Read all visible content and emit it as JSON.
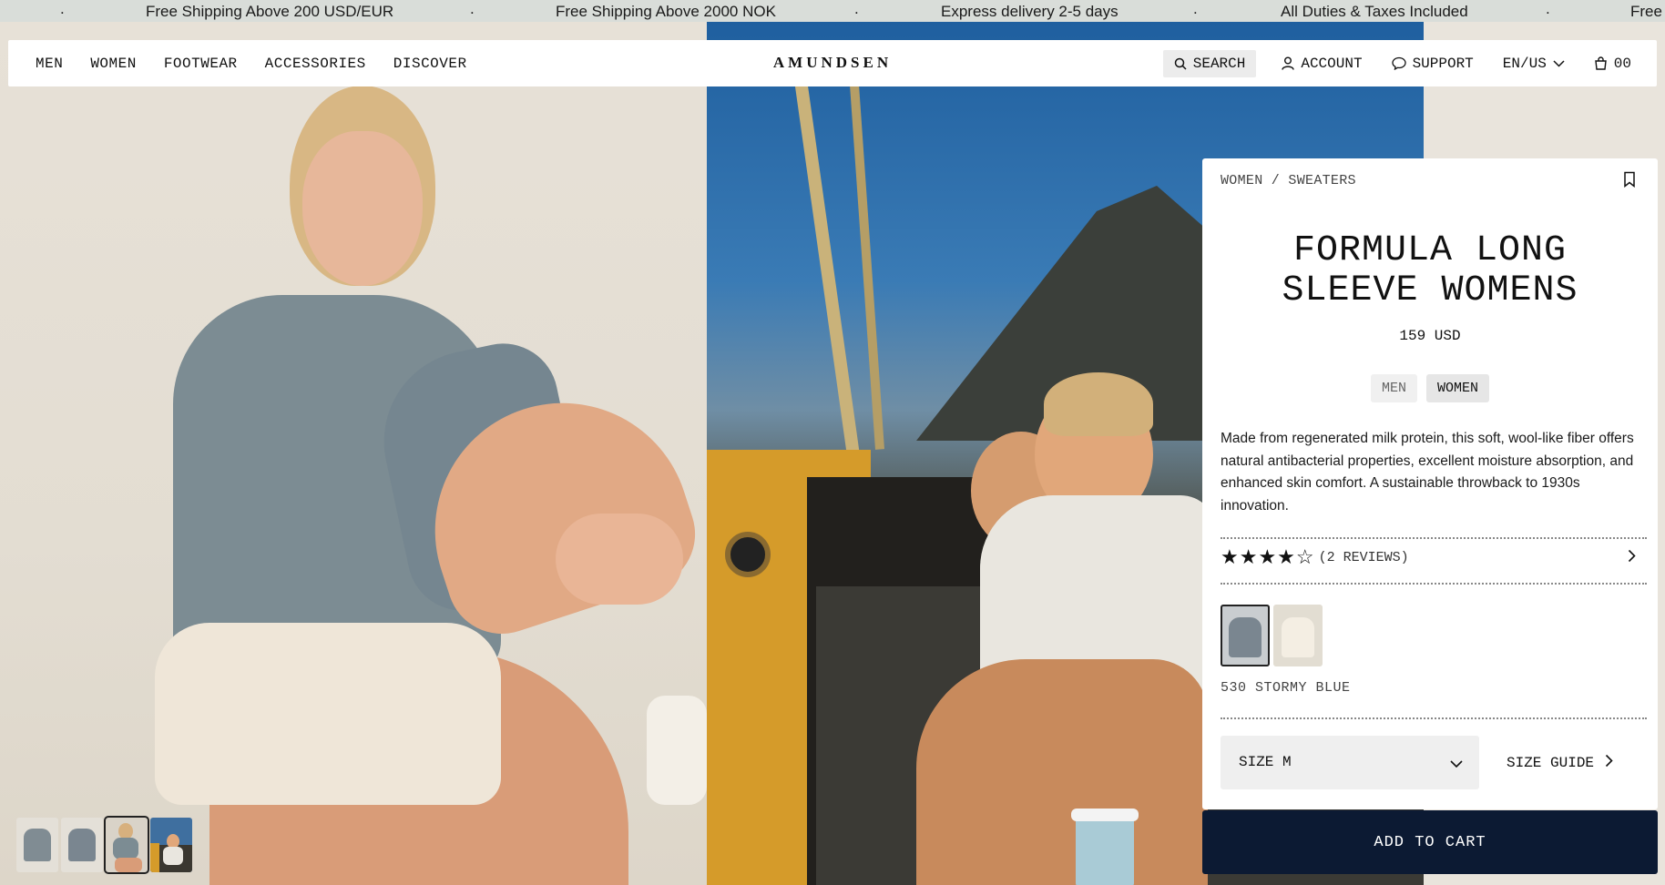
{
  "ticker": {
    "items": [
      "Free Shipping Above 200 USD/EUR",
      "Free Shipping Above 2000 NOK",
      "Express delivery 2-5 days",
      "All Duties & Taxes Included",
      "Free"
    ],
    "separator": "."
  },
  "header": {
    "nav": [
      "MEN",
      "WOMEN",
      "FOOTWEAR",
      "ACCESSORIES",
      "DISCOVER"
    ],
    "logo": "AMUNDSEN",
    "search": "SEARCH",
    "account": "ACCOUNT",
    "support": "SUPPORT",
    "locale": "EN/US",
    "cart_count": "00"
  },
  "product": {
    "breadcrumb": "WOMEN / SWEATERS",
    "title_line1": "FORMULA LONG",
    "title_line2": "SLEEVE WOMENS",
    "price": "159 USD",
    "gender_options": [
      "MEN",
      "WOMEN"
    ],
    "selected_gender": "WOMEN",
    "description": "Made from regenerated milk protein, this soft, wool-like fiber offers natural antibacterial properties, excellent moisture absorption, and enhanced skin comfort. A sustainable throwback to 1930s innovation.",
    "rating": 4,
    "rating_max": 5,
    "reviews_label": "(2 REVIEWS)",
    "colors": [
      {
        "name": "530 STORMY BLUE",
        "swatch": "#7a8690",
        "selected": true
      },
      {
        "name": "CREAM",
        "swatch": "#ece5d8",
        "selected": false
      }
    ],
    "color_name": "530 STORMY BLUE",
    "size_label": "SIZE M",
    "size_guide": "SIZE GUIDE",
    "add_to_cart": "ADD TO CART"
  },
  "gallery": {
    "thumbnail_count": 4,
    "selected_index": 2
  },
  "colors": {
    "accent": "#0c1a33",
    "ticker_bg": "#d9ddd9"
  }
}
